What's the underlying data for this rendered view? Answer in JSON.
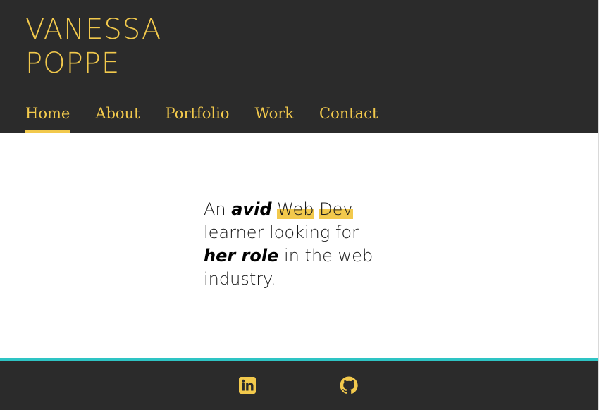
{
  "header": {
    "title_line1": "VANESSA",
    "title_line2": "POPPE"
  },
  "nav": {
    "items": [
      {
        "label": "Home",
        "active": true
      },
      {
        "label": "About",
        "active": false
      },
      {
        "label": "Portfolio",
        "active": false
      },
      {
        "label": "Work",
        "active": false
      },
      {
        "label": "Contact",
        "active": false
      }
    ]
  },
  "hero": {
    "part1": "An ",
    "emph1": "avid",
    "part2": " ",
    "hl1": "Web",
    "part3": " ",
    "hl2": "Dev",
    "part4": " learner looking for ",
    "emph2": "her role",
    "part5": " in the web industry."
  },
  "footer": {
    "icons": [
      "linkedin-icon",
      "github-icon"
    ]
  },
  "colors": {
    "accent": "#f2c94c",
    "header_bg": "#2b2b2b",
    "divider": "#2ec4c4"
  }
}
